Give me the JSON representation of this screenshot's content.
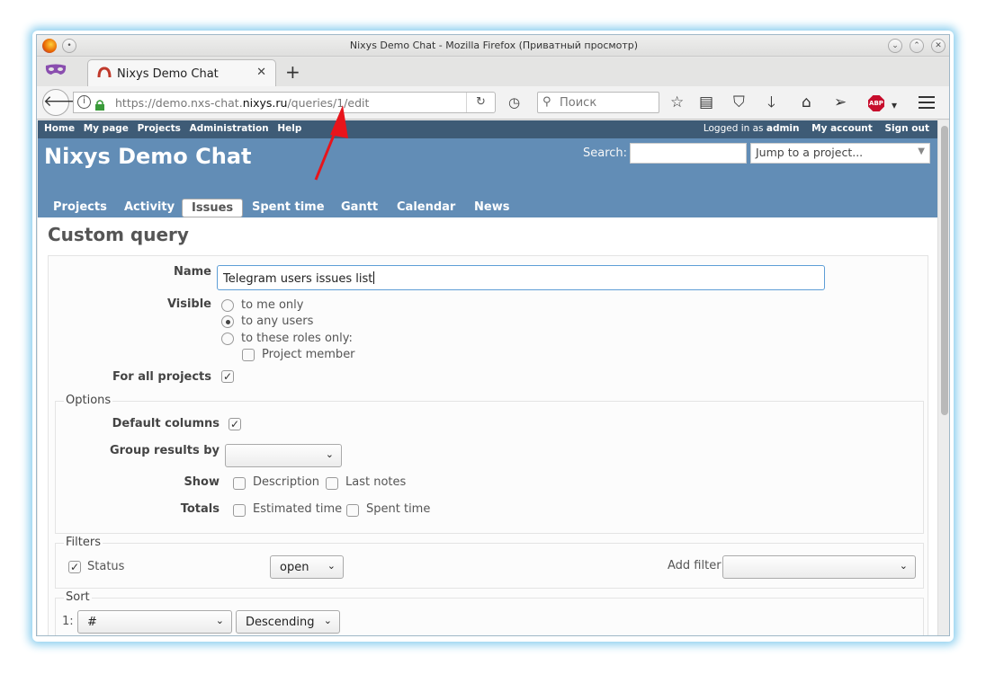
{
  "window": {
    "title": "Nixys Demo Chat - Mozilla Firefox (Приватный просмотр)"
  },
  "browser": {
    "tab_title": "Nixys Demo Chat",
    "url_prefix": "https://demo.nxs-chat.",
    "url_domain": "nixys.ru",
    "url_path": "/queries/1/edit",
    "search_placeholder": "Поиск",
    "abp_label": "ABP"
  },
  "topmenu": {
    "left": [
      "Home",
      "My page",
      "Projects",
      "Administration",
      "Help"
    ],
    "logged_in_as": "Logged in as",
    "user": "admin",
    "my_account": "My account",
    "sign_out": "Sign out"
  },
  "header": {
    "title": "Nixys Demo Chat",
    "search_label": "Search:",
    "jump_placeholder": "Jump to a project..."
  },
  "main_menu": [
    "Projects",
    "Activity",
    "Issues",
    "Spent time",
    "Gantt",
    "Calendar",
    "News"
  ],
  "main_menu_selected": "Issues",
  "page": {
    "title": "Custom query",
    "name_label": "Name",
    "name_value": "Telegram users issues list",
    "visible_label": "Visible",
    "visible_options": [
      "to me only",
      "to any users",
      "to these roles only:"
    ],
    "visible_selected": "to any users",
    "role_project_member": "Project member",
    "for_all_projects_label": "For all projects",
    "for_all_projects_checked": true,
    "options_legend": "Options",
    "default_columns_label": "Default columns",
    "default_columns_checked": true,
    "group_results_label": "Group results by",
    "group_results_value": "",
    "show_label": "Show",
    "show_description": "Description",
    "show_last_notes": "Last notes",
    "totals_label": "Totals",
    "totals_estimated": "Estimated time",
    "totals_spent": "Spent time",
    "filters_legend": "Filters",
    "filter_status_label": "Status",
    "filter_status_checked": true,
    "filter_status_operator": "open",
    "add_filter_label": "Add filter",
    "add_filter_value": "",
    "sort_legend": "Sort",
    "sort_index": "1:",
    "sort_field": "#",
    "sort_direction": "Descending"
  },
  "colors": {
    "header_bg": "#628db6",
    "topmenu_bg": "#3e5b76",
    "annotation_arrow": "#e8141b",
    "focus_border": "#5e9ed6"
  }
}
